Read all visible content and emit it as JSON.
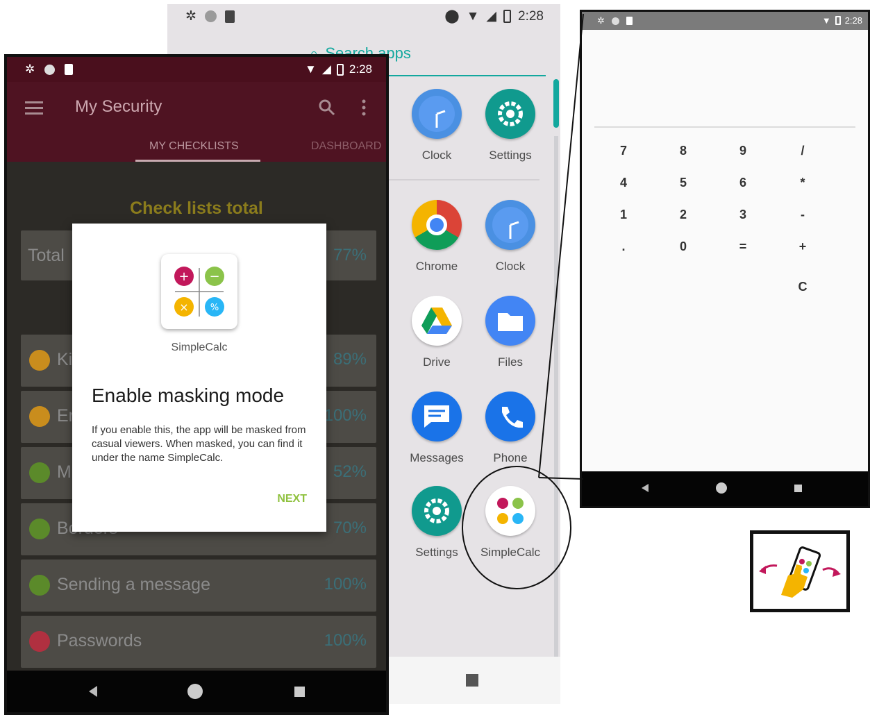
{
  "drawer": {
    "status_time": "2:28",
    "search_placeholder": "Search apps",
    "apps": [
      {
        "label": "Clock",
        "icon": "clock-icon",
        "color": "#4285f4"
      },
      {
        "label": "Settings",
        "icon": "gear-icon",
        "color": "#109a8e"
      },
      {
        "label": "Chrome",
        "icon": "chrome-icon",
        "color": "#db4437"
      },
      {
        "label": "Clock",
        "icon": "clock-icon",
        "color": "#4285f4"
      },
      {
        "label": "Drive",
        "icon": "drive-icon",
        "color": "#ffffff"
      },
      {
        "label": "Files",
        "icon": "folder-icon",
        "color": "#4285f4"
      },
      {
        "label": "Messages",
        "icon": "message-icon",
        "color": "#1a73e8"
      },
      {
        "label": "Phone",
        "icon": "phone-icon",
        "color": "#1a73e8"
      },
      {
        "label": "Settings",
        "icon": "gear-icon",
        "color": "#109a8e"
      },
      {
        "label": "SimpleCalc",
        "icon": "simplecalc-icon",
        "color": "#ffffff"
      }
    ]
  },
  "security": {
    "status_time": "2:28",
    "title": "My Security",
    "tabs": [
      "MY CHECKLISTS",
      "DASHBOARD"
    ],
    "heading": "Check lists total",
    "total": {
      "label": "Total",
      "value": "77%"
    },
    "items": [
      {
        "label": "Ki",
        "value": "89%",
        "color": "#c98d1d"
      },
      {
        "label": "Er",
        "value": "100%",
        "color": "#c98d1d"
      },
      {
        "label": "M",
        "value": "52%",
        "color": "#5b8a2a"
      },
      {
        "label": "Borders",
        "value": "70%",
        "color": "#5b8a2a"
      },
      {
        "label": "Sending a message",
        "value": "100%",
        "color": "#5b8a2a"
      },
      {
        "label": "Passwords",
        "value": "100%",
        "color": "#b03040"
      }
    ]
  },
  "dialog": {
    "app_name": "SimpleCalc",
    "title": "Enable masking mode",
    "body": "If you enable this, the app will be masked from casual viewers. When masked, you can find it under the name SimpleCalc.",
    "next_label": "NEXT"
  },
  "calculator": {
    "status_time": "2:28",
    "keys": [
      [
        "7",
        "8",
        "9",
        "/"
      ],
      [
        "4",
        "5",
        "6",
        "*"
      ],
      [
        "1",
        "2",
        "3",
        "-"
      ],
      [
        ".",
        "0",
        "=",
        "+"
      ],
      [
        "",
        "",
        "",
        "C"
      ]
    ]
  },
  "colors": {
    "accent": "#13a89e",
    "security_bar": "#4f1322",
    "next": "#8fc13e"
  }
}
